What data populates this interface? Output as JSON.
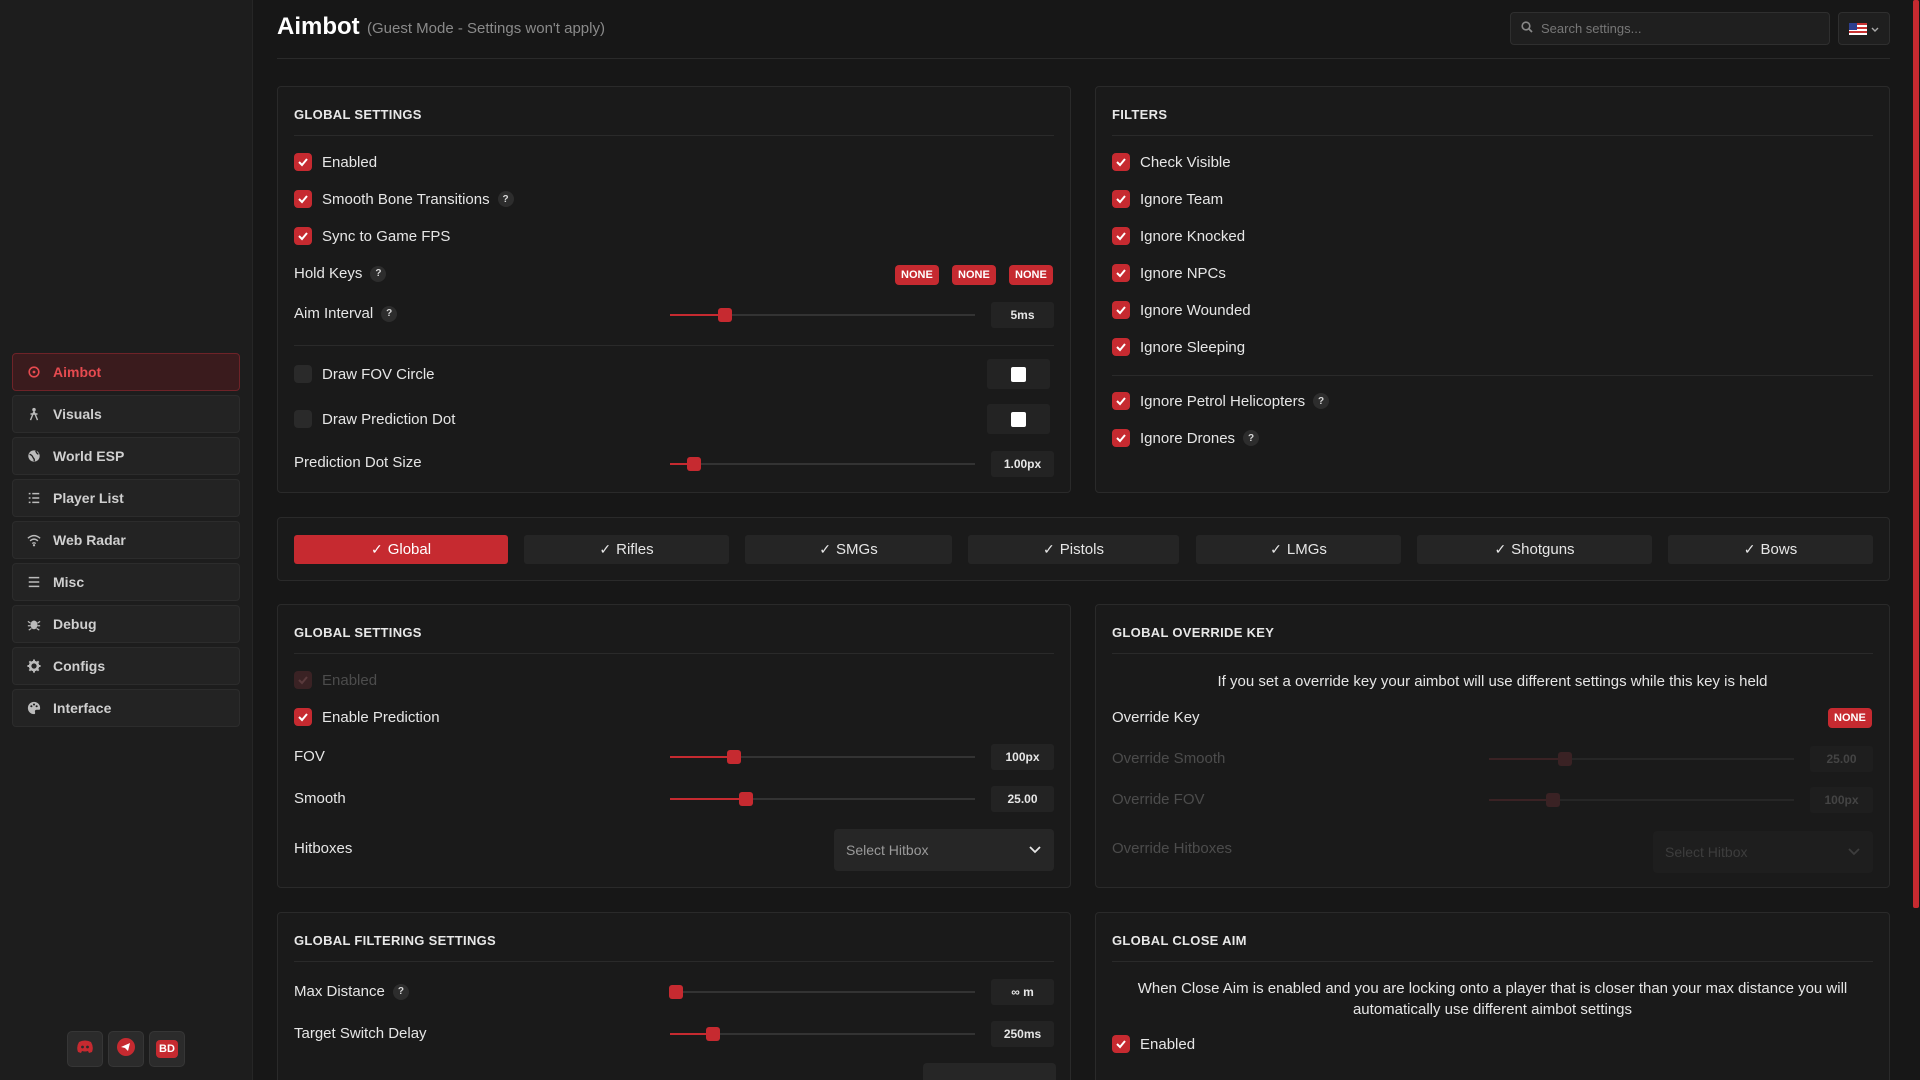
{
  "header": {
    "title": "Aimbot",
    "subtitle": "(Guest Mode - Settings won't apply)",
    "search_placeholder": "Search settings..."
  },
  "sidebar": {
    "items": [
      {
        "label": "Aimbot",
        "icon": "crosshair-icon",
        "active": true
      },
      {
        "label": "Visuals",
        "icon": "person-icon"
      },
      {
        "label": "World ESP",
        "icon": "globe-icon"
      },
      {
        "label": "Player List",
        "icon": "list-icon"
      },
      {
        "label": "Web Radar",
        "icon": "wifi-icon"
      },
      {
        "label": "Misc",
        "icon": "menu-icon"
      },
      {
        "label": "Debug",
        "icon": "bug-icon"
      },
      {
        "label": "Configs",
        "icon": "gear-icon"
      },
      {
        "label": "Interface",
        "icon": "palette-icon"
      }
    ],
    "social": {
      "bd_label": "BD"
    }
  },
  "global_settings": {
    "title": "GLOBAL SETTINGS",
    "enabled": "Enabled",
    "smooth_bone": "Smooth Bone Transitions",
    "sync_fps": "Sync to Game FPS",
    "hold_keys": "Hold Keys",
    "hold_key_values": [
      "NONE",
      "NONE",
      "NONE"
    ],
    "aim_interval": {
      "label": "Aim Interval",
      "value": "5ms",
      "fraction": 0.18
    },
    "draw_fov": "Draw FOV Circle",
    "draw_pred_dot": "Draw Prediction Dot",
    "pred_dot_size": {
      "label": "Prediction Dot Size",
      "value": "1.00px",
      "fraction": 0.08
    }
  },
  "filters": {
    "title": "FILTERS",
    "items": [
      "Check Visible",
      "Ignore Team",
      "Ignore Knocked",
      "Ignore NPCs",
      "Ignore Wounded",
      "Ignore Sleeping"
    ],
    "petrol": "Ignore Petrol Helicopters",
    "drones": "Ignore Drones"
  },
  "tabs": [
    {
      "label": "Global",
      "active": true
    },
    {
      "label": "Rifles"
    },
    {
      "label": "SMGs"
    },
    {
      "label": "Pistols"
    },
    {
      "label": "LMGs"
    },
    {
      "label": "Shotguns"
    },
    {
      "label": "Bows"
    }
  ],
  "weapon_global": {
    "title": "GLOBAL SETTINGS",
    "enabled": "Enabled",
    "enable_prediction": "Enable Prediction",
    "fov": {
      "label": "FOV",
      "value": "100px",
      "fraction": 0.21
    },
    "smooth": {
      "label": "Smooth",
      "value": "25.00",
      "fraction": 0.25
    },
    "hitboxes": {
      "label": "Hitboxes",
      "placeholder": "Select Hitbox"
    }
  },
  "override": {
    "title": "GLOBAL OVERRIDE KEY",
    "info": "If you set a override key your aimbot will use different settings while this key is held",
    "key_label": "Override Key",
    "key_value": "NONE",
    "smooth": {
      "label": "Override Smooth",
      "value": "25.00",
      "fraction": 0.25
    },
    "fov": {
      "label": "Override FOV",
      "value": "100px",
      "fraction": 0.21
    },
    "hitboxes": {
      "label": "Override Hitboxes",
      "placeholder": "Select Hitbox"
    }
  },
  "filtering": {
    "title": "GLOBAL FILTERING SETTINGS",
    "max_distance": {
      "label": "Max Distance",
      "value": "∞ m",
      "fraction": 0.02
    },
    "switch_delay": {
      "label": "Target Switch Delay",
      "value": "250ms",
      "fraction": 0.14
    }
  },
  "close_aim": {
    "title": "GLOBAL CLOSE AIM",
    "info": "When Close Aim is enabled and you are locking onto a player that is closer than your max distance you will automatically use different aimbot settings",
    "enabled": "Enabled"
  },
  "colors": {
    "accent": "#c62a30",
    "bg": "#171717",
    "panel": "#1a1a1a"
  }
}
